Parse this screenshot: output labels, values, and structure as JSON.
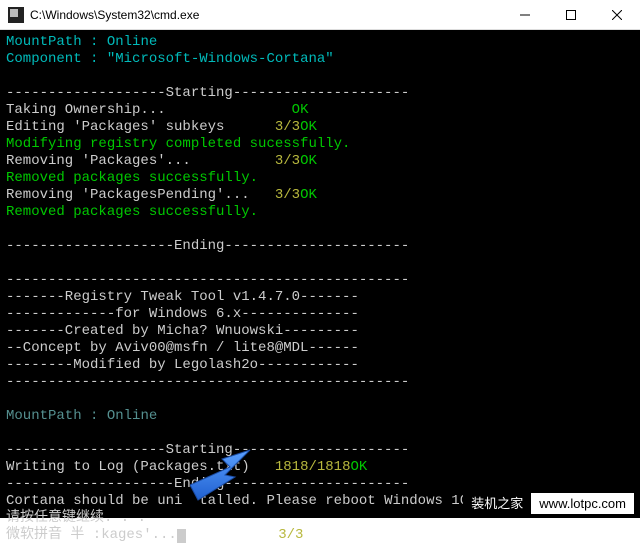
{
  "window": {
    "title": "C:\\Windows\\System32\\cmd.exe"
  },
  "hdr": {
    "mpLabel": "MountPath",
    "mpVal": ": Online",
    "compLabel": "Component",
    "compVal": ": \"Microsoft-Windows-Cortana\""
  },
  "sect": {
    "starting": "-------------------Starting---------------------",
    "ending": "--------------------Ending----------------------",
    "dashes": "------------------------------------------------"
  },
  "log": {
    "l1a": "Taking Ownership...",
    "l1c": "OK",
    "l2a": "Editing 'Packages' subkeys",
    "l2b": "3/3",
    "l2c": "OK",
    "l3": "Modifying registry completed sucessfully.",
    "l4a": "Removing 'Packages'...",
    "l4b": "3/3",
    "l4c": "OK",
    "l5": "Removed packages successfully.",
    "l6a": "Removing 'PackagesPending'...",
    "l6b": "3/3",
    "l6c": "OK",
    "l7": "Removed packages successfully."
  },
  "about": {
    "l1": "-------Registry Tweak Tool v1.4.7.0-------",
    "l2": "-------------for Windows 6.x--------------",
    "l3": "-------Created by Micha? Wnuowski---------",
    "l4": "--Concept by Aviv00@msfn / lite8@MDL------",
    "l5": "--------Modified by Legolash2o------------"
  },
  "hdr2": {
    "mpLabel": "MountPath",
    "mpVal": ": Online"
  },
  "log2": {
    "l1a": "Writing to Log (Packages.tx",
    "l1x": "t)",
    "l1b": "1818/1818",
    "l1c": "OK",
    "finA": "Cortana should be uni",
    "finB": "talled. Please reboot Windows 10.",
    "cont": "请按任意键继续. . .",
    "lastA": "微软拼音 半 :kages'...",
    "lastB": "3/3"
  },
  "watermark": {
    "a": "装机之家",
    "b": "www.lotpc.com"
  }
}
